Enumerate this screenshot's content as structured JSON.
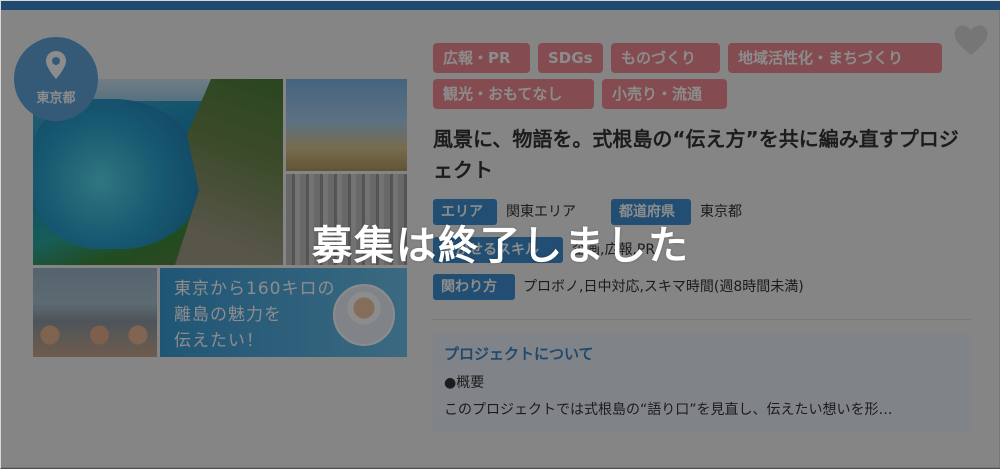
{
  "card": {
    "location_badge": "東京都",
    "image_caption": [
      "東京から160キロの",
      "離島の魅力を",
      "伝えたい！"
    ],
    "tags": [
      "広報・PR",
      "SDGs",
      "ものづくり",
      "地域活性化・まちづくり",
      "観光・おもてなし",
      "小売り・流通"
    ],
    "title": "風景に、物語を。式根島の“伝え方”を共に編み直すプロジェクト",
    "meta": {
      "area_label": "エリア",
      "area_value": "関東エリア",
      "pref_label": "都道府県",
      "pref_value": "東京都",
      "skill_label": "活かせるスキル",
      "skill_value": "企画,広報,PR",
      "involve_label": "関わり方",
      "involve_value": "プロボノ,日中対応,スキマ時間(週8時間未満)"
    },
    "about": {
      "heading": "プロジェクトについて",
      "subheading": "●概要",
      "text": "このプロジェクトでは式根島の“語り口”を見直し、伝えたい想いを形…"
    },
    "overlay_text": "募集は終了しました"
  },
  "colors": {
    "accent_blue": "#3a86c8",
    "tag_pink": "#f08a92",
    "chip_blue": "#3c8fd0",
    "badge_blue": "#5fa5db"
  },
  "icons": {
    "favorite": "heart-icon",
    "location": "map-pin-icon"
  }
}
